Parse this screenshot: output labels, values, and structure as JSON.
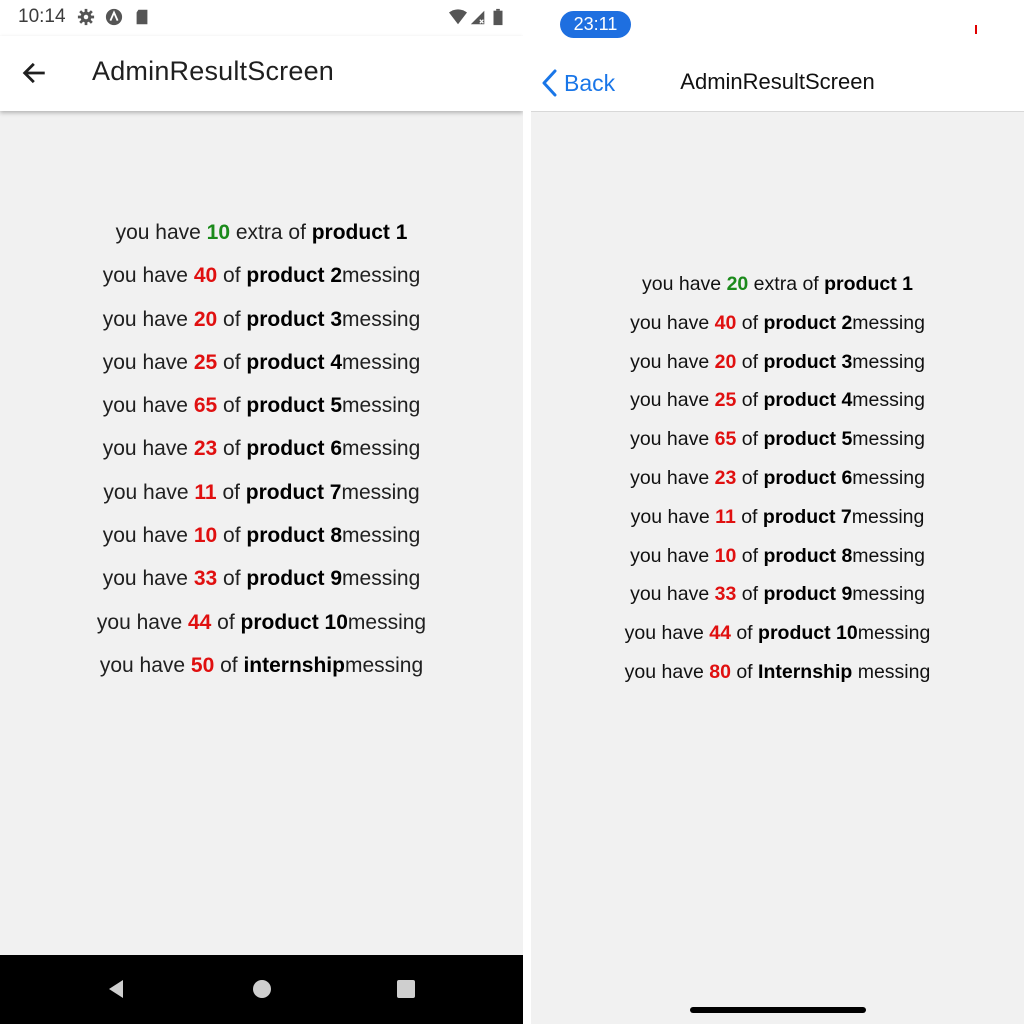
{
  "android": {
    "status_time": "10:14",
    "status_icons": [
      "gear-icon",
      "navigation-app-icon",
      "sd-card-icon",
      "wifi-icon",
      "signal-icon",
      "battery-icon"
    ],
    "title": "AdminResultScreen",
    "lines": [
      {
        "pre": "you have ",
        "num": "10",
        "mid": " extra of ",
        "prod": "product 1",
        "post": "",
        "color": "green"
      },
      {
        "pre": "you have ",
        "num": "40",
        "mid": " of ",
        "prod": "product 2",
        "post": "messing",
        "color": "red"
      },
      {
        "pre": "you have ",
        "num": "20",
        "mid": " of ",
        "prod": "product 3",
        "post": "messing",
        "color": "red"
      },
      {
        "pre": "you have ",
        "num": "25",
        "mid": " of ",
        "prod": "product 4",
        "post": "messing",
        "color": "red"
      },
      {
        "pre": "you have ",
        "num": "65",
        "mid": " of ",
        "prod": "product 5",
        "post": "messing",
        "color": "red"
      },
      {
        "pre": "you have ",
        "num": "23",
        "mid": " of ",
        "prod": "product 6",
        "post": "messing",
        "color": "red"
      },
      {
        "pre": "you have ",
        "num": "11",
        "mid": " of ",
        "prod": "product 7",
        "post": "messing",
        "color": "red"
      },
      {
        "pre": "you have ",
        "num": "10",
        "mid": " of ",
        "prod": "product 8",
        "post": "messing",
        "color": "red"
      },
      {
        "pre": "you have ",
        "num": "33",
        "mid": " of ",
        "prod": "product 9",
        "post": "messing",
        "color": "red"
      },
      {
        "pre": "you have ",
        "num": "44",
        "mid": " of ",
        "prod": "product 10",
        "post": "messing",
        "color": "red"
      },
      {
        "pre": "you have ",
        "num": "50",
        "mid": " of ",
        "prod": "internship",
        "post": "messing",
        "color": "red"
      }
    ]
  },
  "ios": {
    "status_time": "23:11",
    "back_label": "Back",
    "title": "AdminResultScreen",
    "lines": [
      {
        "pre": "you have ",
        "num": "20",
        "mid": " extra of ",
        "prod": "product 1",
        "post": "",
        "color": "green"
      },
      {
        "pre": "you have ",
        "num": "40",
        "mid": " of ",
        "prod": "product 2",
        "post": "messing",
        "color": "red"
      },
      {
        "pre": "you have ",
        "num": "20",
        "mid": " of ",
        "prod": "product 3",
        "post": "messing",
        "color": "red"
      },
      {
        "pre": "you have ",
        "num": "25",
        "mid": " of ",
        "prod": "product 4",
        "post": "messing",
        "color": "red"
      },
      {
        "pre": "you have ",
        "num": "65",
        "mid": " of ",
        "prod": "product 5",
        "post": "messing",
        "color": "red"
      },
      {
        "pre": "you have ",
        "num": "23",
        "mid": " of ",
        "prod": "product 6",
        "post": "messing",
        "color": "red"
      },
      {
        "pre": "you have ",
        "num": "11",
        "mid": " of ",
        "prod": "product 7",
        "post": "messing",
        "color": "red"
      },
      {
        "pre": "you have ",
        "num": "10",
        "mid": " of ",
        "prod": "product 8",
        "post": "messing",
        "color": "red"
      },
      {
        "pre": "you have ",
        "num": "33",
        "mid": " of ",
        "prod": "product 9",
        "post": "messing",
        "color": "red"
      },
      {
        "pre": "you have ",
        "num": "44",
        "mid": " of ",
        "prod": "product 10",
        "post": "messing",
        "color": "red"
      },
      {
        "pre": "you have ",
        "num": "80",
        "mid": " of ",
        "prod": "Internship",
        "post": " messing",
        "color": "red"
      }
    ]
  },
  "colors": {
    "positive": "#1b8a1b",
    "negative": "#e01010",
    "ios_accent": "#1976e8",
    "ios_time_pill": "#1e6fe0"
  }
}
